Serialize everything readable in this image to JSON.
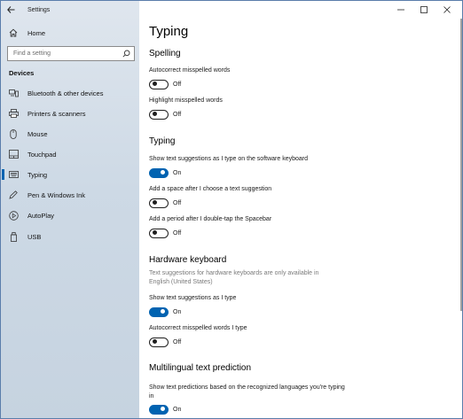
{
  "app_title": "Settings",
  "window_controls": {
    "minimize": "—",
    "maximize": "☐",
    "close": "✕"
  },
  "sidebar": {
    "home_label": "Home",
    "search_placeholder": "Find a setting",
    "section": "Devices",
    "items": [
      {
        "label": "Bluetooth & other devices",
        "icon": "bluetooth-icon"
      },
      {
        "label": "Printers & scanners",
        "icon": "printer-icon"
      },
      {
        "label": "Mouse",
        "icon": "mouse-icon"
      },
      {
        "label": "Touchpad",
        "icon": "touchpad-icon"
      },
      {
        "label": "Typing",
        "icon": "keyboard-icon",
        "active": true
      },
      {
        "label": "Pen & Windows Ink",
        "icon": "pen-icon"
      },
      {
        "label": "AutoPlay",
        "icon": "autoplay-icon"
      },
      {
        "label": "USB",
        "icon": "usb-icon"
      }
    ]
  },
  "main": {
    "title": "Typing",
    "spelling": {
      "heading": "Spelling",
      "autocorrect_label": "Autocorrect misspelled words",
      "autocorrect_state": "Off",
      "highlight_label": "Highlight misspelled words",
      "highlight_state": "Off"
    },
    "typing": {
      "heading": "Typing",
      "suggestions_label": "Show text suggestions as I type on the software keyboard",
      "suggestions_state": "On",
      "space_label": "Add a space after I choose a text suggestion",
      "space_state": "Off",
      "period_label": "Add a period after I double-tap the Spacebar",
      "period_state": "Off"
    },
    "hardware": {
      "heading": "Hardware keyboard",
      "note": "Text suggestions for hardware keyboards are only available in English (United States)",
      "suggestions_label": "Show text suggestions as I type",
      "suggestions_state": "On",
      "autocorrect_label": "Autocorrect misspelled words I type",
      "autocorrect_state": "Off"
    },
    "multilingual": {
      "heading": "Multilingual text prediction",
      "prediction_label": "Show text predictions based on the recognized languages you're typing in",
      "prediction_state": "On"
    }
  },
  "colors": {
    "accent": "#0063b1",
    "sidebar_bg": "#cdd9e5"
  }
}
